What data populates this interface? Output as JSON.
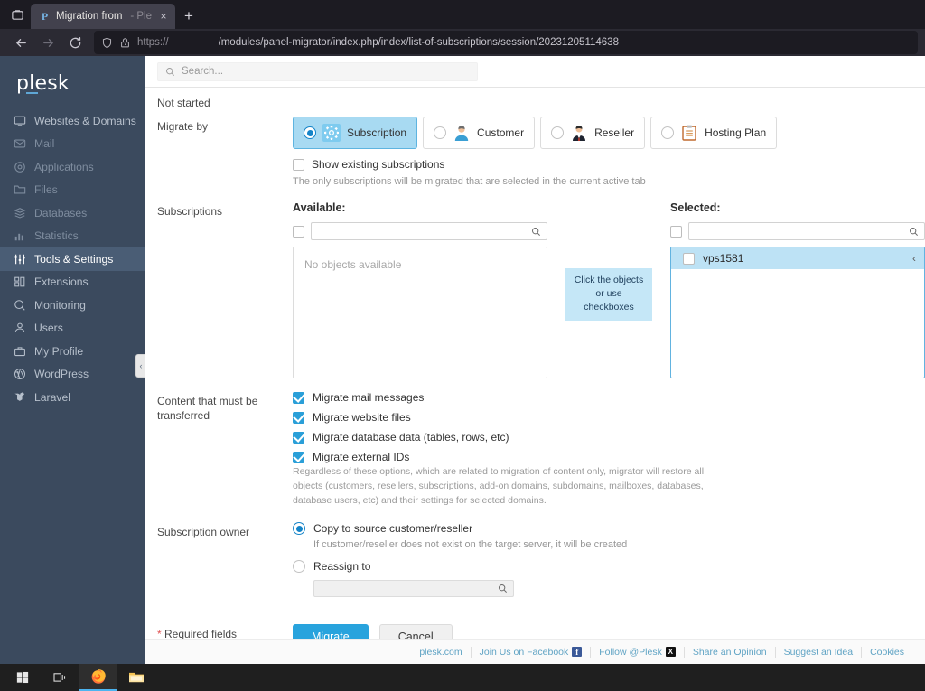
{
  "browser": {
    "tab": {
      "title": "Migration from",
      "suffix": "- Ple",
      "favicon": "plesk-favicon",
      "close": "×"
    },
    "new_tab_label": "+",
    "url_scheme": "https://",
    "url_path": "/modules/panel-migrator/index.php/index/list-of-subscriptions/session/20231205114638"
  },
  "sidebar": {
    "logo": "plesk",
    "items": [
      {
        "label": "Websites & Domains",
        "icon": "monitor-icon",
        "state": "normal"
      },
      {
        "label": "Mail",
        "icon": "envelope-icon",
        "state": "dim"
      },
      {
        "label": "Applications",
        "icon": "gear-circle-icon",
        "state": "dim"
      },
      {
        "label": "Files",
        "icon": "folder-icon",
        "state": "dim"
      },
      {
        "label": "Databases",
        "icon": "database-icon",
        "state": "dim"
      },
      {
        "label": "Statistics",
        "icon": "bar-chart-icon",
        "state": "dim"
      },
      {
        "label": "Tools & Settings",
        "icon": "sliders-icon",
        "state": "active"
      },
      {
        "label": "Extensions",
        "icon": "blocks-icon",
        "state": "normal"
      },
      {
        "label": "Monitoring",
        "icon": "magnifier-gauge-icon",
        "state": "normal"
      },
      {
        "label": "Users",
        "icon": "person-icon",
        "state": "normal"
      },
      {
        "label": "My Profile",
        "icon": "briefcase-icon",
        "state": "normal"
      },
      {
        "label": "WordPress",
        "icon": "wordpress-icon",
        "state": "normal"
      },
      {
        "label": "Laravel",
        "icon": "laravel-icon",
        "state": "normal"
      }
    ],
    "collapse_chevron": "‹"
  },
  "search": {
    "placeholder": "Search...",
    "value": "",
    "icon": "search-icon"
  },
  "status": {
    "text": "Not started"
  },
  "migrate_by": {
    "label": "Migrate by",
    "options": [
      {
        "label": "Subscription",
        "icon": "gear-icon",
        "selected": true
      },
      {
        "label": "Customer",
        "icon": "customer-avatar-icon",
        "selected": false
      },
      {
        "label": "Reseller",
        "icon": "reseller-avatar-icon",
        "selected": false
      },
      {
        "label": "Hosting Plan",
        "icon": "clipboard-icon",
        "selected": false
      }
    ],
    "show_existing": {
      "label": "Show existing subscriptions",
      "checked": false
    },
    "hint": "The only subscriptions will be migrated that are selected in the current active tab"
  },
  "subscriptions": {
    "label": "Subscriptions",
    "available": {
      "title": "Available:",
      "select_all_checked": false,
      "search_value": "",
      "empty_text": "No objects available"
    },
    "tooltip": "Click the objects\nor use\ncheckboxes",
    "tooltip_lines": [
      "Click the objects",
      "or use",
      "checkboxes"
    ],
    "selected": {
      "title": "Selected:",
      "select_all_checked": false,
      "search_value": "",
      "items": [
        {
          "name": "vps1581",
          "checked": false,
          "chevron": "‹"
        }
      ]
    }
  },
  "content_transfer": {
    "label": "Content that must be transferred",
    "options": [
      {
        "label": "Migrate mail messages",
        "checked": true
      },
      {
        "label": "Migrate website files",
        "checked": true
      },
      {
        "label": "Migrate database data (tables, rows, etc)",
        "checked": true
      },
      {
        "label": "Migrate external IDs",
        "checked": true
      }
    ],
    "note": "Regardless of these options, which are related to migration of content only, migrator will restore all objects (customers, resellers, subscriptions, add-on domains, subdomains, mailboxes, databases, database users, etc) and their settings for selected domains."
  },
  "subscription_owner": {
    "label": "Subscription owner",
    "option_copy": {
      "label": "Copy to source customer/reseller",
      "selected": true
    },
    "copy_note": "If customer/reseller does not exist on the target server, it will be created",
    "option_reassign": {
      "label": "Reassign to",
      "selected": false
    },
    "reassign_value": ""
  },
  "actions": {
    "required_star": "*",
    "required_label": "Required fields",
    "primary": "Migrate",
    "secondary": "Cancel"
  },
  "footer": {
    "links": [
      {
        "label": "plesk.com",
        "icon": null
      },
      {
        "label": "Join Us on Facebook",
        "icon": "facebook-icon",
        "glyph": "f"
      },
      {
        "label": "Follow @Plesk",
        "icon": "x-twitter-icon",
        "glyph": "X"
      },
      {
        "label": "Share an Opinion",
        "icon": null
      },
      {
        "label": "Suggest an Idea",
        "icon": null
      },
      {
        "label": "Cookies",
        "icon": null
      }
    ]
  },
  "taskbar": {
    "items": [
      {
        "name": "start-button",
        "icon": "windows-logo-icon",
        "active": false
      },
      {
        "name": "task-view-button",
        "icon": "task-view-icon",
        "active": false
      },
      {
        "name": "firefox-button",
        "icon": "firefox-icon",
        "active": true
      },
      {
        "name": "file-explorer-button",
        "icon": "folder-icon",
        "active": false
      }
    ]
  },
  "colors": {
    "accent": "#28a3dd",
    "sidebar": "#3b4a5e",
    "selected_row": "#bde2f5",
    "tooltip": "#c5e7f7"
  }
}
